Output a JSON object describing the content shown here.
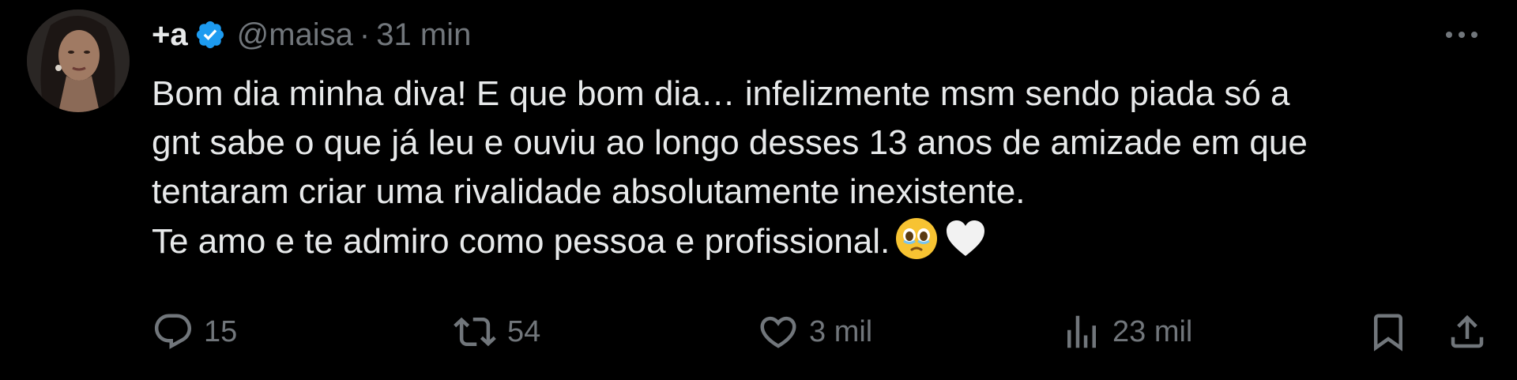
{
  "tweet": {
    "display_name": "+a",
    "handle": "@maisa",
    "separator": "·",
    "time": "31 min",
    "text_lines": [
      "Bom dia minha diva! E que bom dia… infelizmente msm sendo piada só a",
      "gnt sabe o que já leu e ouviu ao longo desses 13 anos de amizade em que",
      "tentaram criar uma rivalidade absolutamente inexistente.",
      "Te amo e te admiro como pessoa e profissional."
    ],
    "emojis": [
      "face-holding-back-tears",
      "white-heart"
    ]
  },
  "actions": {
    "replies": "15",
    "reposts": "54",
    "likes": "3 mil",
    "views": "23 mil"
  },
  "colors": {
    "background": "#000000",
    "text": "#e7e9ea",
    "muted": "#71767b",
    "verified": "#1d9bf0"
  }
}
